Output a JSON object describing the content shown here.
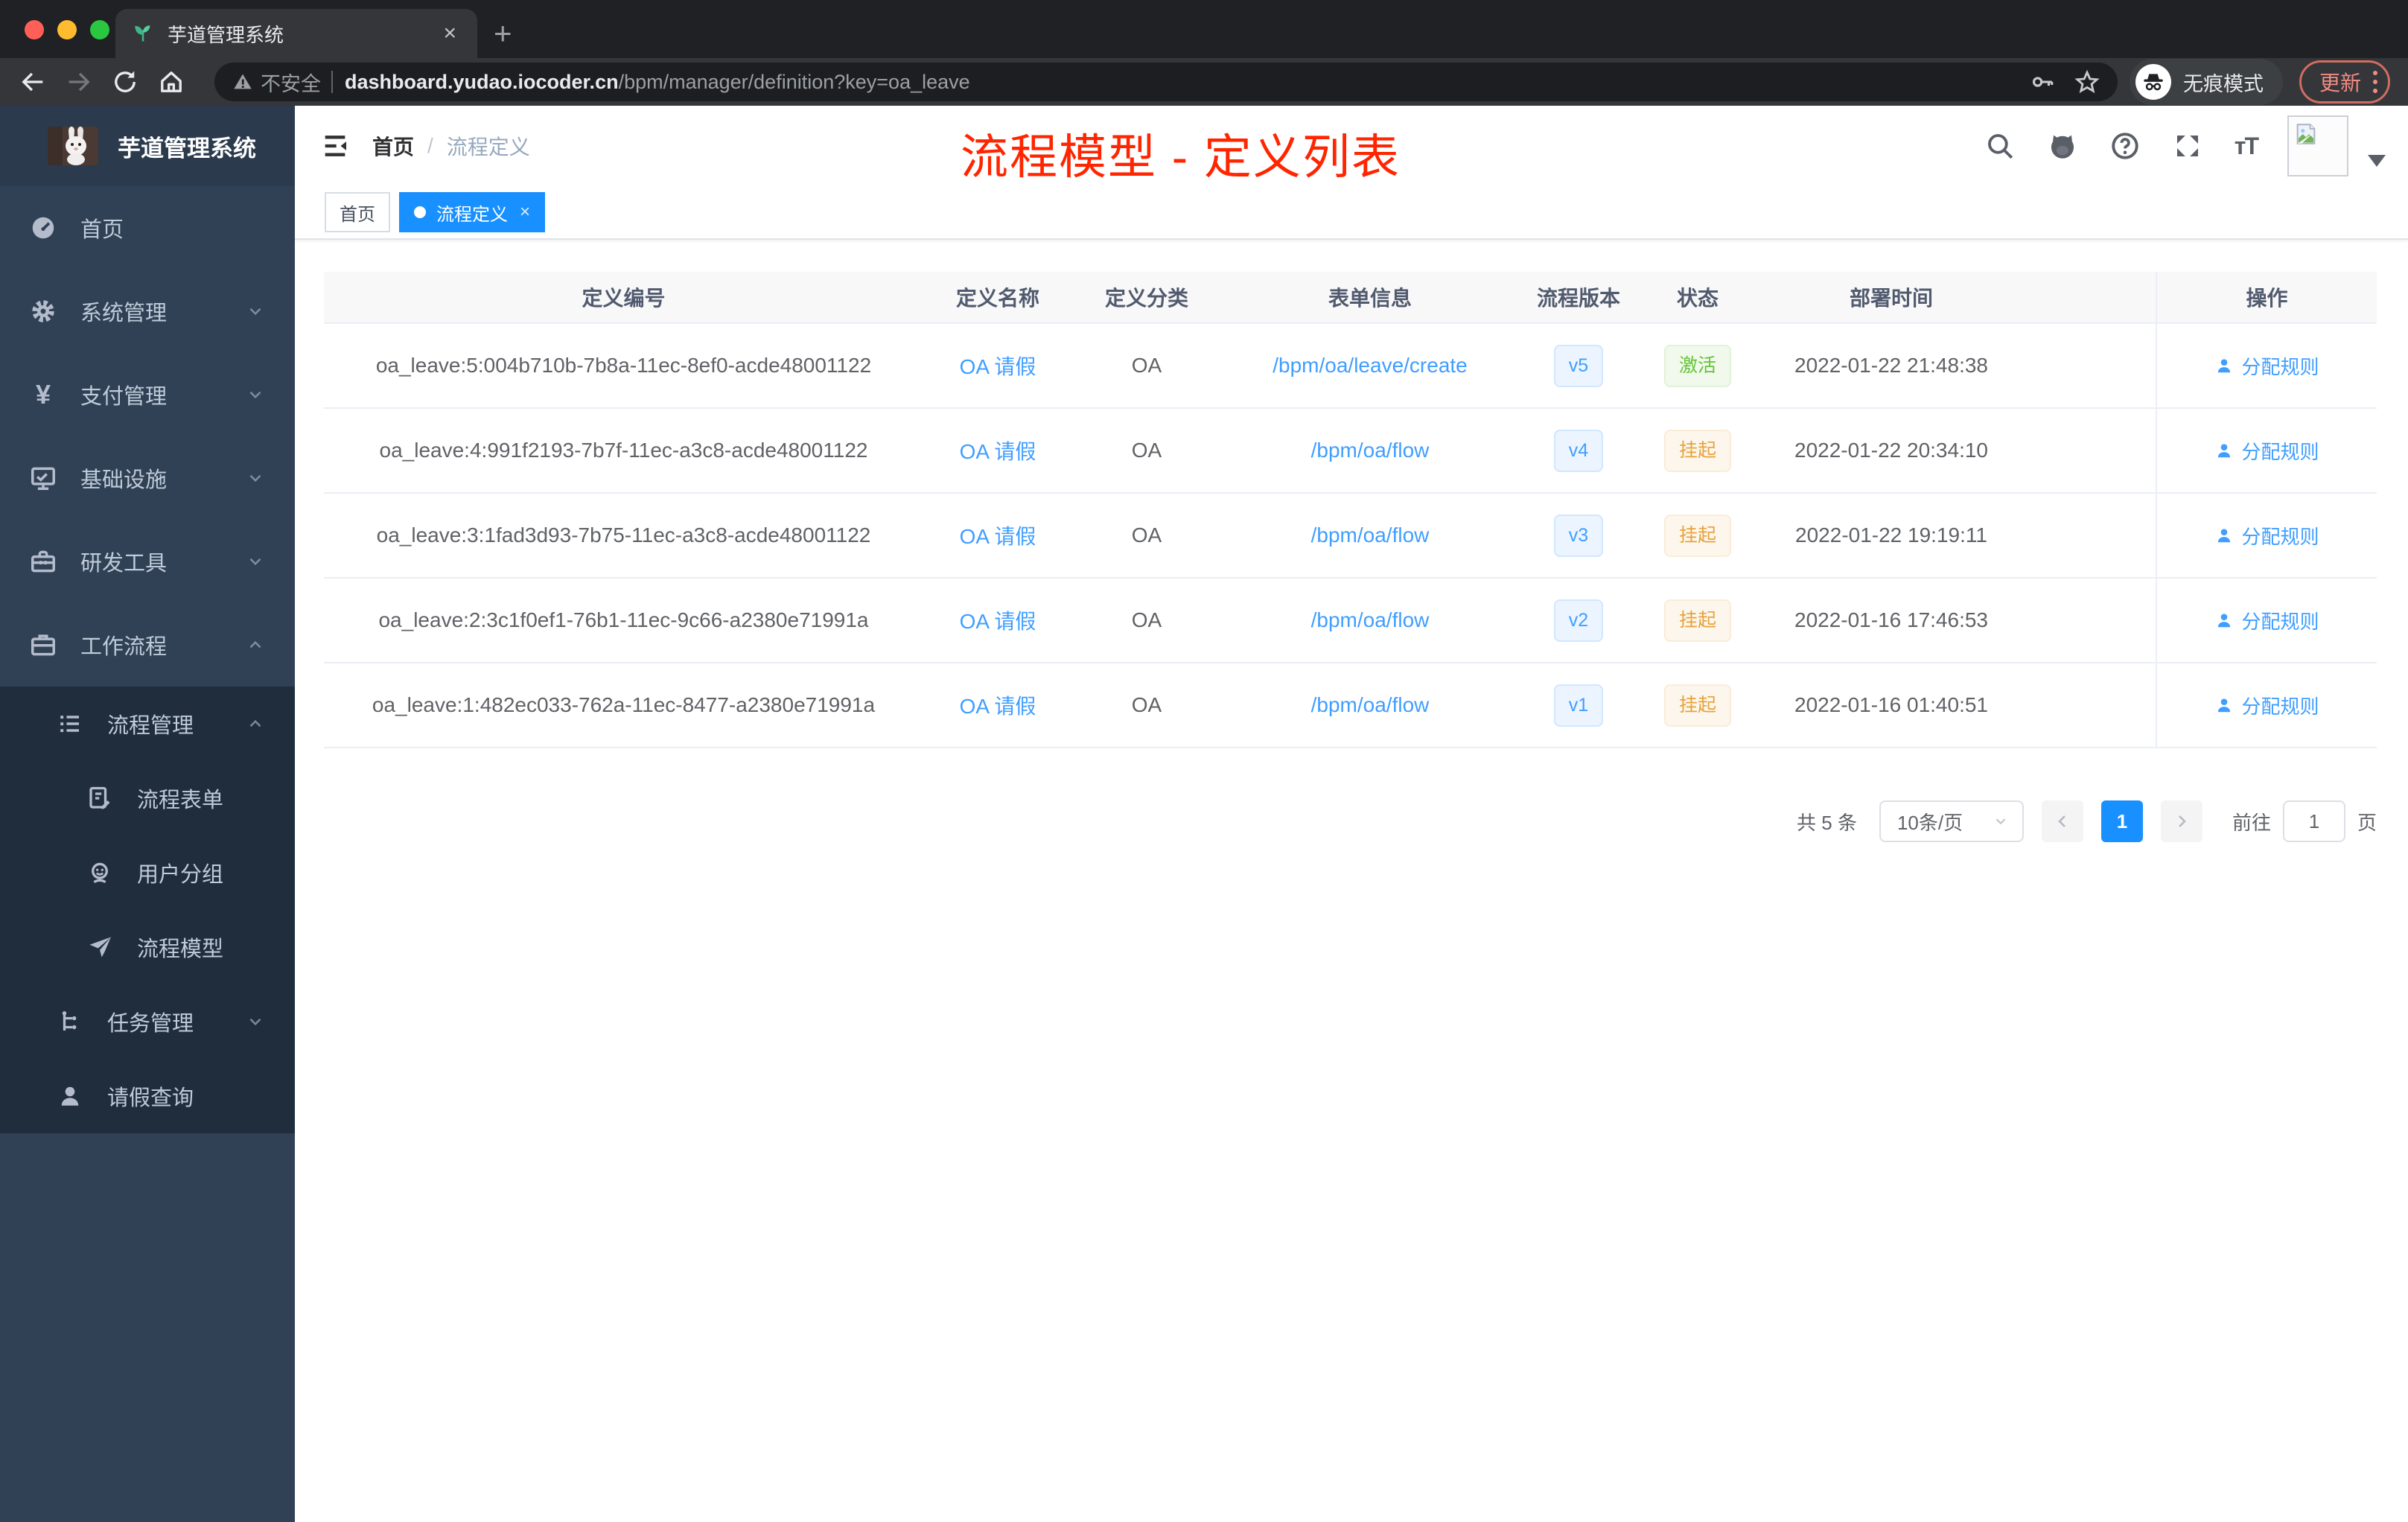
{
  "browser": {
    "tab_title": "芋道管理系统",
    "security_warning": "不安全",
    "url_host": "dashboard.yudao.iocoder.cn",
    "url_path": "/bpm/manager/definition?key=oa_leave",
    "incognito_label": "无痕模式",
    "update_label": "更新"
  },
  "sidebar": {
    "app_title": "芋道管理系统",
    "items": [
      {
        "label": "首页"
      },
      {
        "label": "系统管理"
      },
      {
        "label": "支付管理"
      },
      {
        "label": "基础设施"
      },
      {
        "label": "研发工具"
      },
      {
        "label": "工作流程"
      },
      {
        "label": "流程管理"
      },
      {
        "label": "流程表单"
      },
      {
        "label": "用户分组"
      },
      {
        "label": "流程模型"
      },
      {
        "label": "任务管理"
      },
      {
        "label": "请假查询"
      }
    ]
  },
  "header": {
    "breadcrumb_home": "首页",
    "breadcrumb_sep": "/",
    "breadcrumb_current": "流程定义",
    "annotation": "流程模型 - 定义列表"
  },
  "tags": {
    "home": "首页",
    "active": "流程定义"
  },
  "table": {
    "columns": [
      "定义编号",
      "定义名称",
      "定义分类",
      "表单信息",
      "流程版本",
      "状态",
      "部署时间",
      "操作"
    ],
    "rows": [
      {
        "id": "oa_leave:5:004b710b-7b8a-11ec-8ef0-acde48001122",
        "name": "OA 请假",
        "category": "OA",
        "form": "/bpm/oa/leave/create",
        "version": "v5",
        "status": "激活",
        "status_type": "active",
        "time": "2022-01-22 21:48:38",
        "action": "分配规则"
      },
      {
        "id": "oa_leave:4:991f2193-7b7f-11ec-a3c8-acde48001122",
        "name": "OA 请假",
        "category": "OA",
        "form": "/bpm/oa/flow",
        "version": "v4",
        "status": "挂起",
        "status_type": "suspended",
        "time": "2022-01-22 20:34:10",
        "action": "分配规则"
      },
      {
        "id": "oa_leave:3:1fad3d93-7b75-11ec-a3c8-acde48001122",
        "name": "OA 请假",
        "category": "OA",
        "form": "/bpm/oa/flow",
        "version": "v3",
        "status": "挂起",
        "status_type": "suspended",
        "time": "2022-01-22 19:19:11",
        "action": "分配规则"
      },
      {
        "id": "oa_leave:2:3c1f0ef1-76b1-11ec-9c66-a2380e71991a",
        "name": "OA 请假",
        "category": "OA",
        "form": "/bpm/oa/flow",
        "version": "v2",
        "status": "挂起",
        "status_type": "suspended",
        "time": "2022-01-16 17:46:53",
        "action": "分配规则"
      },
      {
        "id": "oa_leave:1:482ec033-762a-11ec-8477-a2380e71991a",
        "name": "OA 请假",
        "category": "OA",
        "form": "/bpm/oa/flow",
        "version": "v1",
        "status": "挂起",
        "status_type": "suspended",
        "time": "2022-01-16 01:40:51",
        "action": "分配规则"
      }
    ]
  },
  "pagination": {
    "total": "共 5 条",
    "page_size": "10条/页",
    "current_page": "1",
    "goto_label": "前往",
    "goto_value": "1",
    "page_unit": "页"
  }
}
